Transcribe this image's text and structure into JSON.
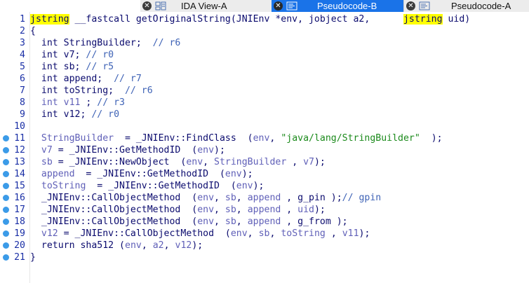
{
  "tabs": [
    {
      "label": "IDA View-A",
      "active": false
    },
    {
      "label": "Pseudocode-B",
      "active": true
    },
    {
      "label": "Pseudocode-A",
      "active": false
    }
  ],
  "colors": {
    "active_tab": "#1a73e8",
    "highlight": "#ffff00",
    "breakpoint_dot": "#3b9be8",
    "string_literal": "#1b8a1b"
  },
  "code": {
    "lines": [
      {
        "n": "1",
        "dot": false,
        "tokens": [
          [
            "hl",
            "jstring"
          ],
          [
            "pn",
            " __fastcall getOriginalString(JNIEnv *env, jobject a2,      "
          ],
          [
            "hl",
            "jstring"
          ],
          [
            "pn",
            " uid)"
          ]
        ]
      },
      {
        "n": "2",
        "dot": false,
        "tokens": [
          [
            "pn",
            "{"
          ]
        ]
      },
      {
        "n": "3",
        "dot": false,
        "tokens": [
          [
            "kw",
            "  int StringBuilder;  "
          ],
          [
            "cm",
            "// r6"
          ]
        ]
      },
      {
        "n": "4",
        "dot": false,
        "tokens": [
          [
            "kw",
            "  int v7; "
          ],
          [
            "cm",
            "// r0"
          ]
        ]
      },
      {
        "n": "5",
        "dot": false,
        "tokens": [
          [
            "kw",
            "  int sb; "
          ],
          [
            "cm",
            "// r5"
          ]
        ]
      },
      {
        "n": "6",
        "dot": false,
        "tokens": [
          [
            "kw",
            "  int append;  "
          ],
          [
            "cm",
            "// r7"
          ]
        ]
      },
      {
        "n": "7",
        "dot": false,
        "tokens": [
          [
            "kw",
            "  int toString;  "
          ],
          [
            "cm",
            "// r6"
          ]
        ]
      },
      {
        "n": "8",
        "dot": false,
        "tokens": [
          [
            "var",
            "  int v11"
          ],
          [
            "kw",
            " ; "
          ],
          [
            "cm",
            "// r3"
          ]
        ]
      },
      {
        "n": "9",
        "dot": false,
        "tokens": [
          [
            "kw",
            "  int v12; "
          ],
          [
            "cm",
            "// r0"
          ]
        ]
      },
      {
        "n": "10",
        "dot": false,
        "tokens": [
          [
            "pn",
            ""
          ]
        ]
      },
      {
        "n": "11",
        "dot": true,
        "tokens": [
          [
            "var",
            "  StringBuilder"
          ],
          [
            "pn",
            "  = _JNIEnv::FindClass  ("
          ],
          [
            "var",
            "env"
          ],
          [
            "pn",
            ", "
          ],
          [
            "str",
            "\"java/lang/StringBuilder\""
          ],
          [
            "pn",
            "  );"
          ]
        ]
      },
      {
        "n": "12",
        "dot": true,
        "tokens": [
          [
            "var",
            "  v7"
          ],
          [
            "pn",
            " = _JNIEnv::GetMethodID  ("
          ],
          [
            "var",
            "env"
          ],
          [
            "pn",
            ");"
          ]
        ]
      },
      {
        "n": "13",
        "dot": true,
        "tokens": [
          [
            "var",
            "  sb"
          ],
          [
            "pn",
            " = _JNIEnv::NewObject  ("
          ],
          [
            "var",
            "env"
          ],
          [
            "pn",
            ", "
          ],
          [
            "var",
            "StringBuilder"
          ],
          [
            "pn",
            " , "
          ],
          [
            "var",
            "v7"
          ],
          [
            "pn",
            ");"
          ]
        ]
      },
      {
        "n": "14",
        "dot": true,
        "tokens": [
          [
            "var",
            "  append"
          ],
          [
            "pn",
            "  = _JNIEnv::GetMethodID  ("
          ],
          [
            "var",
            "env"
          ],
          [
            "pn",
            ");"
          ]
        ]
      },
      {
        "n": "15",
        "dot": true,
        "tokens": [
          [
            "var",
            "  toString"
          ],
          [
            "pn",
            "  = _JNIEnv::GetMethodID  ("
          ],
          [
            "var",
            "env"
          ],
          [
            "pn",
            ");"
          ]
        ]
      },
      {
        "n": "16",
        "dot": true,
        "tokens": [
          [
            "pn",
            "  _JNIEnv::CallObjectMethod  ("
          ],
          [
            "var",
            "env"
          ],
          [
            "pn",
            ", "
          ],
          [
            "var",
            "sb"
          ],
          [
            "pn",
            ", "
          ],
          [
            "var",
            "append"
          ],
          [
            "pn",
            " , g_pin );"
          ],
          [
            "cm",
            "// gpin"
          ]
        ]
      },
      {
        "n": "17",
        "dot": true,
        "tokens": [
          [
            "pn",
            "  _JNIEnv::CallObjectMethod  ("
          ],
          [
            "var",
            "env"
          ],
          [
            "pn",
            ", "
          ],
          [
            "var",
            "sb"
          ],
          [
            "pn",
            ", "
          ],
          [
            "var",
            "append"
          ],
          [
            "pn",
            " , "
          ],
          [
            "var",
            "uid"
          ],
          [
            "pn",
            ");"
          ]
        ]
      },
      {
        "n": "18",
        "dot": true,
        "tokens": [
          [
            "pn",
            "  _JNIEnv::CallObjectMethod  ("
          ],
          [
            "var",
            "env"
          ],
          [
            "pn",
            ", "
          ],
          [
            "var",
            "sb"
          ],
          [
            "pn",
            ", "
          ],
          [
            "var",
            "append"
          ],
          [
            "pn",
            " , g_from );"
          ]
        ]
      },
      {
        "n": "19",
        "dot": true,
        "tokens": [
          [
            "var",
            "  v12"
          ],
          [
            "pn",
            " = _JNIEnv::CallObjectMethod  ("
          ],
          [
            "var",
            "env"
          ],
          [
            "pn",
            ", "
          ],
          [
            "var",
            "sb"
          ],
          [
            "pn",
            ", "
          ],
          [
            "var",
            "toString"
          ],
          [
            "pn",
            " , "
          ],
          [
            "var",
            "v11"
          ],
          [
            "pn",
            ");"
          ]
        ]
      },
      {
        "n": "20",
        "dot": true,
        "tokens": [
          [
            "kw",
            "  return "
          ],
          [
            "pn",
            "sha512 ("
          ],
          [
            "var",
            "env"
          ],
          [
            "pn",
            ", "
          ],
          [
            "var",
            "a2"
          ],
          [
            "pn",
            ", "
          ],
          [
            "var",
            "v12"
          ],
          [
            "pn",
            ");"
          ]
        ]
      },
      {
        "n": "21",
        "dot": true,
        "tokens": [
          [
            "pn",
            "}"
          ]
        ]
      }
    ]
  }
}
